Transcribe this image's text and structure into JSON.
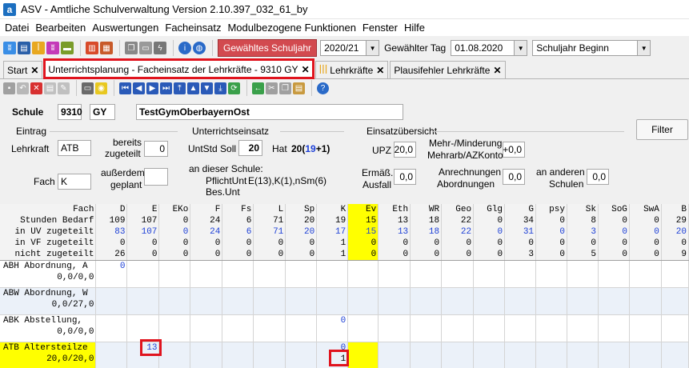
{
  "window": {
    "title": "ASV - Amtliche Schulverwaltung Version 2.10.397_032_61_by",
    "app_letter": "a"
  },
  "menu": [
    "Datei",
    "Bearbeiten",
    "Auswertungen",
    "Facheinsatz",
    "Modulbezogene Funktionen",
    "Fenster",
    "Hilfe"
  ],
  "toolbar": {
    "selected_year_label": "Gewähltes Schuljahr",
    "year_value": "2020/21",
    "day_label": "Gewählter Tag",
    "day_value": "01.08.2020",
    "period_value": "Schuljahr Beginn"
  },
  "tabs": [
    {
      "label": "Start",
      "closable": true
    },
    {
      "label": "Unterrichtsplanung - Facheinsatz der Lehrkräfte - 9310 GY",
      "closable": true,
      "active": true
    },
    {
      "label": "Lehrkräfte",
      "closable": true
    },
    {
      "label": "Plausifehler Lehrkräfte",
      "closable": true
    }
  ],
  "school": {
    "label": "Schule",
    "number": "9310",
    "type": "GY",
    "name": "TestGymOberbayernOst"
  },
  "eintrag": {
    "group": "Eintrag",
    "lehrkraft_label": "Lehrkraft",
    "lehrkraft": "ATB",
    "fach_label": "Fach",
    "fach": "K",
    "bereits_label1": "bereits",
    "bereits_label2": "zugeteilt",
    "bereits": "0",
    "ausserdem_label1": "außerdem",
    "ausserdem_label2": "geplant",
    "ausserdem": ""
  },
  "unterricht": {
    "group": "Unterrichtseinsatz",
    "soll_label": "UntStd Soll",
    "soll": "20",
    "hat_label": "Hat",
    "hat_prefix": "20(",
    "hat_blue": "19",
    "hat_suffix": "+1)",
    "schule_label": "an dieser Schule:",
    "pflicht_label": "PflichtUnt",
    "pflicht_value": "E(13),K(1),nSm(6)",
    "bes_label": "Bes.Unt"
  },
  "uebersicht": {
    "group": "Einsatzübersicht",
    "upz_label": "UPZ",
    "upz": "20,0",
    "mehr_label1": "Mehr-/Minderung",
    "mehr_label2": "Mehrarb/AZKonto",
    "mehr": "+0,0",
    "erm_label1": "Ermäß.",
    "erm_label2": "Ausfall",
    "erm": "0,0",
    "anr_label1": "Anrechnungen",
    "anr_label2": "Abordnungen",
    "anr": "0,0",
    "and_label1": "an anderen",
    "and_label2": "Schulen",
    "and": "0,0"
  },
  "filter_button": "Filter",
  "grid": {
    "header": [
      "Fach",
      "D",
      "E",
      "EKo",
      "F",
      "Fs",
      "L",
      "Sp",
      "K",
      "Ev",
      "Eth",
      "WR",
      "Geo",
      "Glg",
      "G",
      "psy",
      "Sk",
      "SoG",
      "SwA",
      "B"
    ],
    "summary": [
      {
        "label": "Stunden Bedarf",
        "values": [
          "109",
          "107",
          "0",
          "24",
          "6",
          "71",
          "20",
          "19",
          "15",
          "13",
          "18",
          "22",
          "0",
          "34",
          "0",
          "8",
          "0",
          "0",
          "29"
        ]
      },
      {
        "label": "in UV zugeteilt",
        "values": [
          "83",
          "107",
          "0",
          "24",
          "6",
          "71",
          "20",
          "17",
          "15",
          "13",
          "18",
          "22",
          "0",
          "31",
          "0",
          "3",
          "0",
          "0",
          "20"
        ]
      },
      {
        "label": "in VF zugeteilt",
        "values": [
          "0",
          "0",
          "0",
          "0",
          "0",
          "0",
          "0",
          "1",
          "0",
          "0",
          "0",
          "0",
          "0",
          "0",
          "0",
          "0",
          "0",
          "0",
          "0"
        ]
      },
      {
        "label": "nicht zugeteilt",
        "values": [
          "26",
          "0",
          "0",
          "0",
          "0",
          "0",
          "0",
          "1",
          "0",
          "0",
          "0",
          "0",
          "0",
          "3",
          "0",
          "5",
          "0",
          "0",
          "9"
        ]
      }
    ],
    "rows": [
      {
        "name": "ABH Abordnung, A",
        "sub": "0,0/0,0",
        "cells": {
          "0": "0"
        }
      },
      {
        "name": "ABW Abordnung, W",
        "sub": "0,0/27,0",
        "cells": {}
      },
      {
        "name": "ABK Abstellung,",
        "sub": "0,0/0,0",
        "cells": {
          "7": "0"
        }
      },
      {
        "name": "ATB Altersteilze",
        "sub": "20,0/20,0",
        "cells": {
          "1": "13",
          "7": "0",
          "7b": "1"
        }
      }
    ]
  }
}
